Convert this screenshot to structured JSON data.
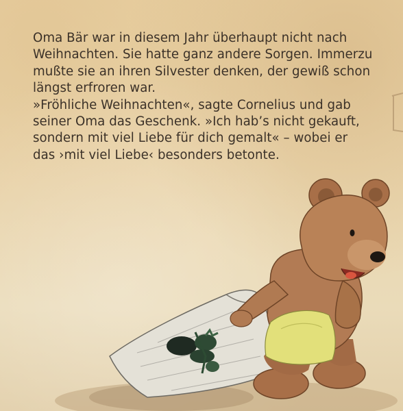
{
  "page": {
    "text_lines": [
      "Oma Bär war in diesem Jahr überhaupt nicht nach",
      "Weihnachten. Sie hatte ganz andere Sorgen. Immerzu",
      "mußte sie an ihren Silvester denken, der gewiß schon",
      "längst erfroren war.",
      "»Fröhliche Weihnachten«, sagte Cornelius und gab",
      "seiner Oma das Geschenk. »Ich hab’s nicht gekauft,",
      "sondern mit viel Liebe für dich gemalt« – wobei er",
      "das ›mit viel Liebe‹ besonders betonte."
    ]
  },
  "illustration": {
    "subject": "bear-cub-with-painting",
    "colors": {
      "paper": "#ecd7ae",
      "fur": "#b07a52",
      "fur_shadow": "#8a5a38",
      "shirt": "#e3e27a",
      "nose": "#1d1712",
      "tongue": "#d9553f",
      "painting_paper": "#e6e3da",
      "painting_leaves": "#27402c"
    }
  }
}
